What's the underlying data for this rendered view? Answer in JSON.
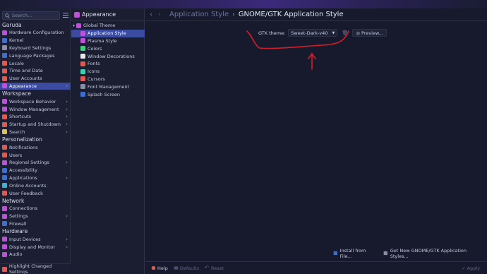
{
  "sidebar": {
    "search_placeholder": "Search...",
    "sections": [
      {
        "label": "Garuda",
        "items": [
          {
            "label": "Hardware Configuration",
            "color": "#c04fd9",
            "chev": false
          },
          {
            "label": "Kernel",
            "color": "#3b6fd1",
            "chev": false
          },
          {
            "label": "Keyboard Settings",
            "color": "#8a8fa8",
            "chev": false
          },
          {
            "label": "Language Packages",
            "color": "#3b6fd1",
            "chev": false
          },
          {
            "label": "Locale",
            "color": "#e05a4e",
            "chev": false
          },
          {
            "label": "Time and Date",
            "color": "#e05a4e",
            "chev": false
          },
          {
            "label": "User Accounts",
            "color": "#e05a4e",
            "chev": false
          }
        ]
      },
      {
        "label": "",
        "items": [
          {
            "label": "Appearance",
            "color": "#c04fd9",
            "chev": true,
            "active": true
          }
        ]
      },
      {
        "label": "Workspace",
        "items": [
          {
            "label": "Workspace Behavior",
            "color": "#c04fd9",
            "chev": true
          },
          {
            "label": "Window Management",
            "color": "#c04fd9",
            "chev": true
          },
          {
            "label": "Shortcuts",
            "color": "#e05a4e",
            "chev": true
          },
          {
            "label": "Startup and Shutdown",
            "color": "#e05a4e",
            "chev": true
          },
          {
            "label": "Search",
            "color": "#e0c04e",
            "chev": true
          }
        ]
      },
      {
        "label": "Personalization",
        "items": [
          {
            "label": "Notifications",
            "color": "#e05a4e",
            "chev": false
          },
          {
            "label": "Users",
            "color": "#e05a4e",
            "chev": false
          },
          {
            "label": "Regional Settings",
            "color": "#c04fd9",
            "chev": true
          },
          {
            "label": "Accessibility",
            "color": "#3b6fd1",
            "chev": false
          },
          {
            "label": "Applications",
            "color": "#3b6fd1",
            "chev": true
          },
          {
            "label": "Online Accounts",
            "color": "#3bb4d1",
            "chev": false
          },
          {
            "label": "User Feedback",
            "color": "#e05a4e",
            "chev": false
          }
        ]
      },
      {
        "label": "Network",
        "items": [
          {
            "label": "Connections",
            "color": "#c04fd9",
            "chev": false
          },
          {
            "label": "Settings",
            "color": "#c04fd9",
            "chev": true
          },
          {
            "label": "Firewall",
            "color": "#3b6fd1",
            "chev": false
          }
        ]
      },
      {
        "label": "Hardware",
        "items": [
          {
            "label": "Input Devices",
            "color": "#c04fd9",
            "chev": true
          },
          {
            "label": "Display and Monitor",
            "color": "#c04fd9",
            "chev": true
          },
          {
            "label": "Audio",
            "color": "#c04fd9",
            "chev": false
          }
        ]
      }
    ],
    "highlight_label": "Highlight Changed Settings"
  },
  "midpane": {
    "title": "Appearance",
    "items": [
      {
        "label": "Global Theme",
        "level": "top",
        "color": "#c04fd9"
      },
      {
        "label": "Application Style",
        "level": "sub",
        "color": "#c04fd9",
        "active": true
      },
      {
        "label": "Plasma Style",
        "level": "sub",
        "color": "#c04fd9"
      },
      {
        "label": "Colors",
        "level": "sub",
        "color": "#3bd17a"
      },
      {
        "label": "Window Decorations",
        "level": "sub",
        "color": "#e8e8ee"
      },
      {
        "label": "Fonts",
        "level": "sub",
        "color": "#e05a4e"
      },
      {
        "label": "Icons",
        "level": "sub",
        "color": "#3bd1b0"
      },
      {
        "label": "Cursors",
        "level": "sub",
        "color": "#e05a4e"
      },
      {
        "label": "Font Management",
        "level": "sub",
        "color": "#8a8fa8"
      },
      {
        "label": "Splash Screen",
        "level": "sub",
        "color": "#3b6fd1"
      }
    ]
  },
  "main": {
    "breadcrumb_prev": "Application Style",
    "breadcrumb_sep": "›",
    "breadcrumb_current": "GNOME/GTK Application Style",
    "gtk_label": "GTK theme:",
    "gtk_value": "Sweet-Dark-v40",
    "preview_label": "Preview...",
    "install_label": "Install from File...",
    "get_new_label": "Get New GNOME/GTK Application Styles...",
    "help_label": "Help",
    "defaults_label": "Defaults",
    "reset_label": "Reset",
    "apply_label": "Apply",
    "annotation_color": "#d41f2a"
  }
}
